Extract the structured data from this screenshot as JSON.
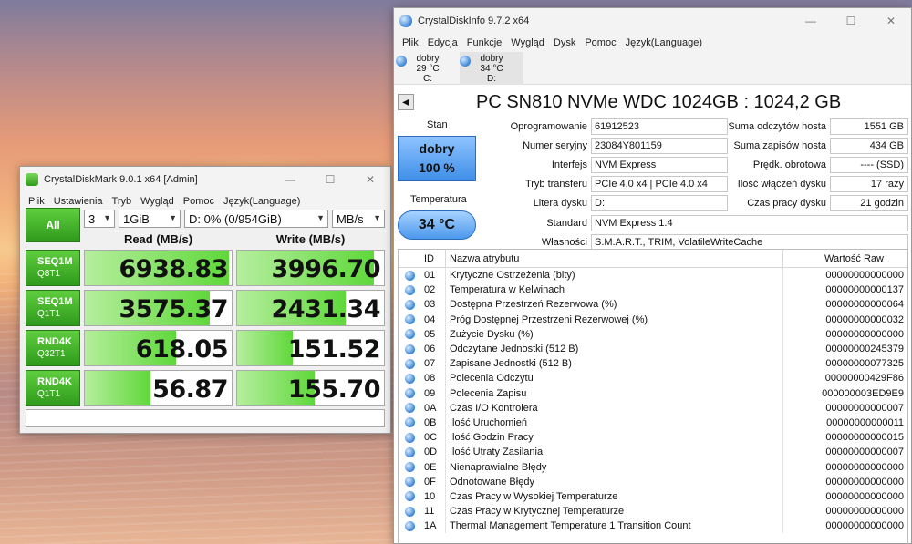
{
  "cdm": {
    "title": "CrystalDiskMark 9.0.1 x64 [Admin]",
    "menu": [
      "Plik",
      "Ustawienia",
      "Tryb",
      "Wygląd",
      "Pomoc",
      "Język(Language)"
    ],
    "all_label": "All",
    "count": "3",
    "size": "1GiB",
    "drive": "D: 0% (0/954GiB)",
    "unit": "MB/s",
    "read_header": "Read (MB/s)",
    "write_header": "Write (MB/s)",
    "tests": [
      {
        "l1": "SEQ1M",
        "l2": "Q8T1",
        "read": "6938.83",
        "write": "3996.70",
        "read_frac": 0.98,
        "write_frac": 0.93
      },
      {
        "l1": "SEQ1M",
        "l2": "Q1T1",
        "read": "3575.37",
        "write": "2431.34",
        "read_frac": 0.85,
        "write_frac": 0.74
      },
      {
        "l1": "RND4K",
        "l2": "Q32T1",
        "read": "618.05",
        "write": "151.52",
        "read_frac": 0.62,
        "write_frac": 0.38
      },
      {
        "l1": "RND4K",
        "l2": "Q1T1",
        "read": "56.87",
        "write": "155.70",
        "read_frac": 0.45,
        "write_frac": 0.53
      }
    ],
    "accent": "#2f9a1c"
  },
  "cdi": {
    "title": "CrystalDiskInfo 9.7.2 x64",
    "menu": [
      "Plik",
      "Edycja",
      "Funkcje",
      "Wygląd",
      "Dysk",
      "Pomoc",
      "Język(Language)"
    ],
    "drives": [
      {
        "status": "dobry",
        "temp": "29 °C",
        "letter": "C:"
      },
      {
        "status": "dobry",
        "temp": "34 °C",
        "letter": "D:"
      }
    ],
    "disk_title": "PC SN810 NVMe WDC 1024GB : 1024,2 GB",
    "stan_label": "Stan",
    "health_status": "dobry",
    "health_pct": "100 %",
    "temp_label": "Temperatura",
    "temp_value": "34 °C",
    "left_info": [
      {
        "label": "Oprogramowanie",
        "value": "61912523"
      },
      {
        "label": "Numer seryjny",
        "value": "23084Y801159"
      },
      {
        "label": "Interfejs",
        "value": "NVM Express"
      },
      {
        "label": "Tryb transferu",
        "value": "PCIe 4.0 x4 | PCIe 4.0 x4"
      },
      {
        "label": "Litera dysku",
        "value": "D:"
      },
      {
        "label": "Standard",
        "value": "NVM Express 1.4"
      },
      {
        "label": "Własności",
        "value": "S.M.A.R.T., TRIM, VolatileWriteCache"
      }
    ],
    "right_info": [
      {
        "label": "Suma odczytów hosta",
        "value": "1551 GB"
      },
      {
        "label": "Suma zapisów hosta",
        "value": "434 GB"
      },
      {
        "label": "Prędk. obrotowa",
        "value": "---- (SSD)"
      },
      {
        "label": "Ilość włączeń dysku",
        "value": "17 razy"
      },
      {
        "label": "Czas pracy dysku",
        "value": "21 godzin"
      }
    ],
    "table_headers": {
      "id": "ID",
      "name": "Nazwa atrybutu",
      "raw": "Wartość Raw"
    },
    "attributes": [
      {
        "id": "01",
        "name": "Krytyczne Ostrzeżenia (bity)",
        "raw": "00000000000000"
      },
      {
        "id": "02",
        "name": "Temperatura w Kelwinach",
        "raw": "00000000000137"
      },
      {
        "id": "03",
        "name": "Dostępna Przestrzeń Rezerwowa (%)",
        "raw": "00000000000064"
      },
      {
        "id": "04",
        "name": "Próg Dostępnej Przestrzeni Rezerwowej (%)",
        "raw": "00000000000032"
      },
      {
        "id": "05",
        "name": "Zużycie Dysku (%)",
        "raw": "00000000000000"
      },
      {
        "id": "06",
        "name": "Odczytane Jednostki (512 B)",
        "raw": "00000000245379"
      },
      {
        "id": "07",
        "name": "Zapisane Jednostki (512 B)",
        "raw": "00000000077325"
      },
      {
        "id": "08",
        "name": "Polecenia Odczytu",
        "raw": "00000000429F86"
      },
      {
        "id": "09",
        "name": "Polecenia Zapisu",
        "raw": "000000003ED9E9"
      },
      {
        "id": "0A",
        "name": "Czas I/O Kontrolera",
        "raw": "00000000000007"
      },
      {
        "id": "0B",
        "name": "Ilość Uruchomień",
        "raw": "00000000000011"
      },
      {
        "id": "0C",
        "name": "Ilość Godzin Pracy",
        "raw": "00000000000015"
      },
      {
        "id": "0D",
        "name": "Ilość Utraty Zasilania",
        "raw": "00000000000007"
      },
      {
        "id": "0E",
        "name": "Nienaprawialne Błędy",
        "raw": "00000000000000"
      },
      {
        "id": "0F",
        "name": "Odnotowane Błędy",
        "raw": "00000000000000"
      },
      {
        "id": "10",
        "name": "Czas Pracy w Wysokiej Temperaturze",
        "raw": "00000000000000"
      },
      {
        "id": "11",
        "name": "Czas Pracy w Krytycznej Temperaturze",
        "raw": "00000000000000"
      },
      {
        "id": "1A",
        "name": "Thermal Management Temperature 1 Transition Count",
        "raw": "00000000000000"
      }
    ],
    "accent": "#3a84d6"
  }
}
